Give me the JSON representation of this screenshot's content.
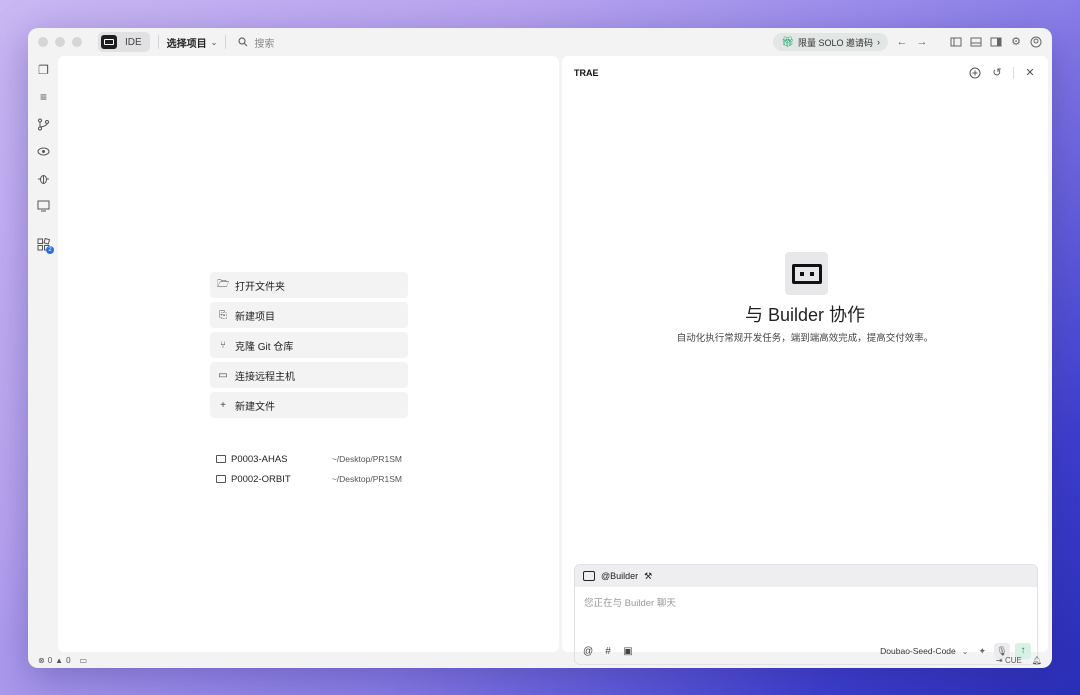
{
  "titlebar": {
    "mode_label": "IDE",
    "project_select": "选择项目",
    "search_placeholder": "搜索",
    "solo_invite": "限量 SOLO 邀请码",
    "solo_chevron": "›"
  },
  "activity": {
    "extensions_badge": "2"
  },
  "welcome": {
    "actions": [
      {
        "label": "打开文件夹",
        "icon": "folder-open-icon"
      },
      {
        "label": "新建项目",
        "icon": "new-project-icon"
      },
      {
        "label": "克隆 Git 仓库",
        "icon": "git-branch-icon"
      },
      {
        "label": "连接远程主机",
        "icon": "remote-terminal-icon"
      },
      {
        "label": "新建文件",
        "icon": "plus-icon"
      }
    ],
    "recent": [
      {
        "name": "P0003-AHAS",
        "path": "~/Desktop/PR1SM"
      },
      {
        "name": "P0002-ORBIT",
        "path": "~/Desktop/PR1SM"
      }
    ]
  },
  "panel": {
    "title": "TRAE",
    "hero_title": "与 Builder 协作",
    "hero_subtitle": "自动化执行常规开发任务，端到端高效完成，提高交付效率。",
    "chat": {
      "agent_label": "@Builder",
      "input_placeholder": "您正在与 Builder 聊天",
      "model": "Doubao-Seed-Code"
    }
  },
  "statusbar": {
    "errors": "0",
    "warnings": "0",
    "cue_label": "CUE"
  },
  "colors": {
    "accent_green": "#1aa36b",
    "badge_blue": "#2b6de0"
  }
}
